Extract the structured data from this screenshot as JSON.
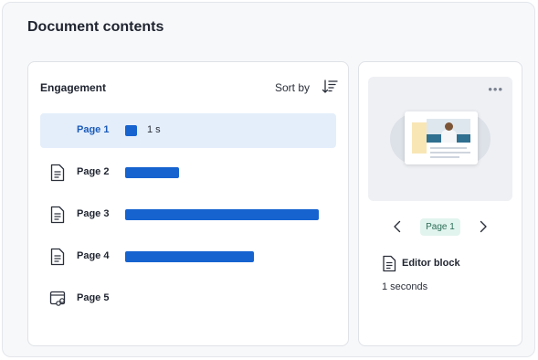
{
  "page": {
    "title": "Document contents"
  },
  "engagement": {
    "title": "Engagement",
    "sort_label": "Sort by",
    "rows": [
      {
        "label": "Page 1",
        "value_label": "1 s",
        "value": 1,
        "icon": "none",
        "selected": true
      },
      {
        "label": "Page 2",
        "value": 5,
        "icon": "document-icon"
      },
      {
        "label": "Page 3",
        "value": 18,
        "icon": "document-icon"
      },
      {
        "label": "Page 4",
        "value": 12,
        "icon": "document-icon"
      },
      {
        "label": "Page 5",
        "value": 0,
        "icon": "embed-link-icon"
      }
    ],
    "max_value": 18
  },
  "preview": {
    "page_label": "Page 1",
    "block_label": "Editor block",
    "duration": "1 seconds"
  },
  "colors": {
    "accent": "#1663cf",
    "selected_row": "#e4eefb",
    "selected_text": "#1a5bb8",
    "pill_bg": "#e2f4ee",
    "pill_text": "#2b6e57"
  }
}
